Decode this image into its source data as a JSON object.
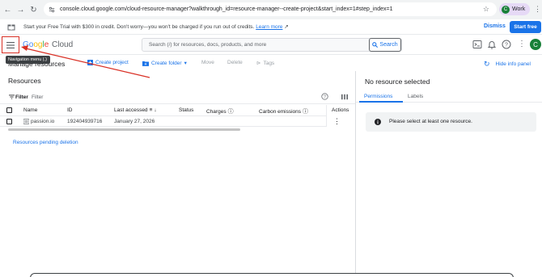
{
  "browser": {
    "url": "console.cloud.google.com/cloud-resource-manager?walkthrough_id=resource-manager--create-project&start_index=1#step_index=1",
    "profile_initial": "C",
    "profile_label": "Work"
  },
  "banner": {
    "message": "Start your Free Trial with $300 in credit. Don't worry—you won't be charged if you run out of credits.",
    "learn_more": "Learn more",
    "dismiss": "Dismiss",
    "start_free": "Start free"
  },
  "header": {
    "logo_g": "Go",
    "logo_o": "og",
    "logo_l": "l",
    "logo_e": "e",
    "logo_cloud": "Cloud",
    "search_placeholder": "Search (/) for resources, docs, products, and more",
    "search_button": "Search",
    "user_initial": "C",
    "tooltip": "Navigation menu (.)"
  },
  "toolbar": {
    "page_title": "Manage resources",
    "create_project": "Create project",
    "create_folder": "Create folder",
    "move": "Move",
    "delete": "Delete",
    "tags": "Tags",
    "hide_info": "Hide info panel"
  },
  "resources": {
    "heading": "Resources",
    "filter_label": "Filter",
    "filter_placeholder": "Filter",
    "columns": {
      "name": "Name",
      "id": "ID",
      "last_accessed": "Last accessed",
      "status": "Status",
      "charges": "Charges",
      "carbon": "Carbon emissions",
      "actions": "Actions"
    },
    "rows": [
      {
        "name": "passion.io",
        "id": "192404939716",
        "last_accessed": "January 27, 2026"
      }
    ],
    "pending_deletion": "Resources pending deletion"
  },
  "info_panel": {
    "title": "No resource selected",
    "tabs": [
      "Permissions",
      "Labels"
    ],
    "message": "Please select at least one resource."
  },
  "colors": {
    "accent": "#1a73e8",
    "annotation": "#d93025",
    "avatar": "#188038"
  }
}
